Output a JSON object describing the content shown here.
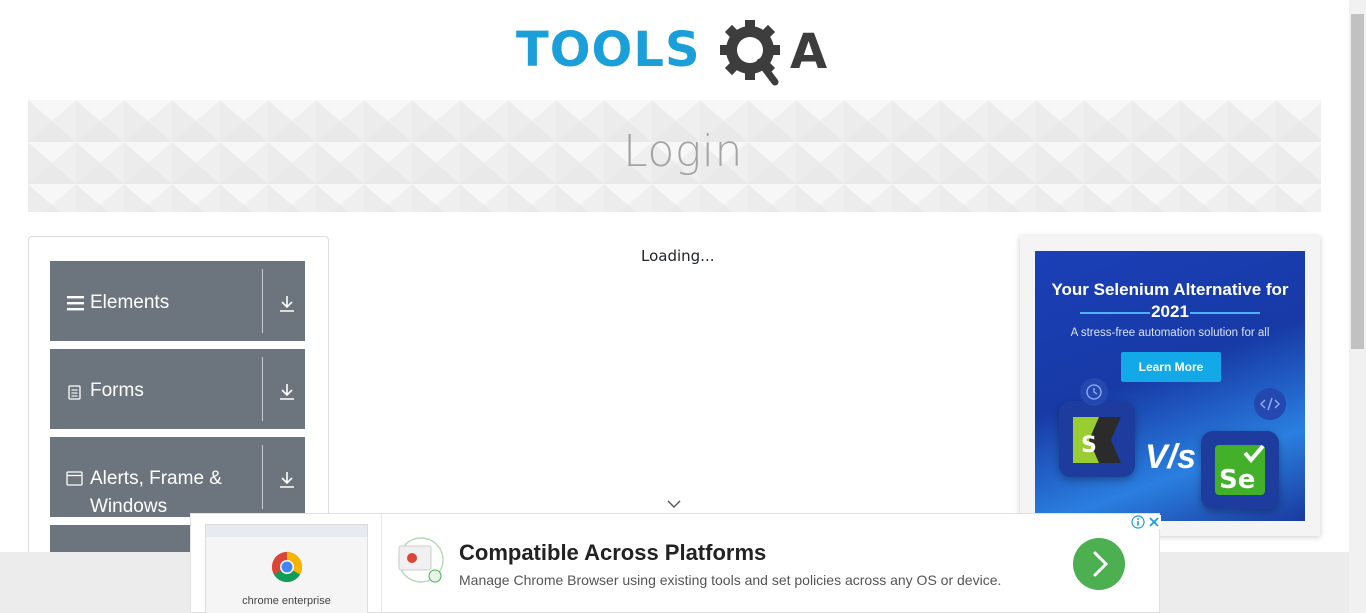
{
  "header": {
    "logo_text": "TOOLS",
    "logo_suffix": "A"
  },
  "banner": {
    "title": "Login"
  },
  "sidebar": {
    "groups": [
      {
        "label": "Elements",
        "icon": "hamburger-icon"
      },
      {
        "label": "Forms",
        "icon": "document-icon"
      },
      {
        "label": "Alerts, Frame & Windows",
        "icon": "window-icon"
      }
    ]
  },
  "main": {
    "loading_text": "Loading..."
  },
  "right_ad": {
    "title": "Your Selenium Alternative for 2021",
    "subtitle": "A stress-free automation solution for all",
    "button_label": "Learn More",
    "vs_text": "V/s"
  },
  "bottom_ad": {
    "brand": "chrome enterprise",
    "title": "Compatible Across Platforms",
    "description": "Manage Chrome Browser using existing tools and set policies across any OS or device."
  },
  "colors": {
    "brand_blue": "#1a9fd9",
    "brand_dark": "#3d3d3d",
    "nav_gray": "#6c757d",
    "go_green": "#4caf50"
  }
}
